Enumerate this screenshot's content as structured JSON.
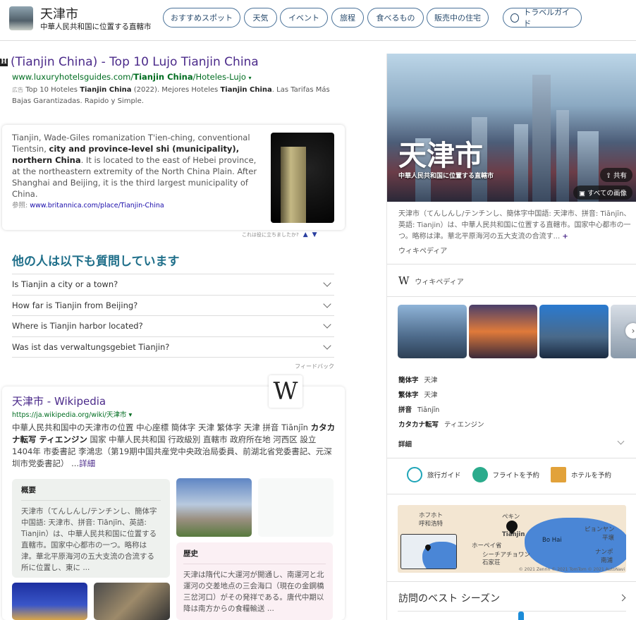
{
  "header": {
    "title": "天津市",
    "subtitle": "中華人民共和国に位置する直轄市",
    "pills": [
      "おすすめスポット",
      "天気",
      "イベント",
      "旅程",
      "食べるもの",
      "販売中の住宅"
    ],
    "travel_guide": "トラベルガイド"
  },
  "ad": {
    "title": "(Tianjin China) - Top 10 Lujo Tianjin China",
    "url_pre": "www.luxuryhotelsguides.com/",
    "url_bold": "Tianjin China",
    "url_post": "/Hoteles-Lujo",
    "ad_label": "広告",
    "desc_1": "Top 10 Hoteles ",
    "desc_b1": "Tianjin China",
    "desc_2": " (2022). Mejores Hoteles ",
    "desc_b2": "Tianjin China",
    "desc_3": ". Las Tarifas Más Bajas Garantizadas. Rapido y Simple."
  },
  "answer": {
    "text_1": "Tianjin, Wade-Giles romanization T'ien-ching, conventional Tientsin, ",
    "text_bold": "city and province-level shi (municipality), northern China",
    "text_2": ". It is located to the east of Hebei province, at the northeastern extremity of the North China Plain. After Shanghai and Beijing, it is the third largest municipality of China.",
    "ref_label": "参照: ",
    "ref_link": "www.britannica.com/place/Tianjin-China",
    "feedback": "これは役に立ちましたか?"
  },
  "paa": {
    "title": "他の人は以下も質問しています",
    "questions": [
      "Is Tianjin a city or a town?",
      "How far is Tianjin from Beijing?",
      "Where is Tianjin harbor located?",
      "Was ist das verwaltungsgebiet Tianjin?"
    ],
    "feedback": "フィードバック"
  },
  "wiki": {
    "logo": "W",
    "title": "天津市 - Wikipedia",
    "url": "https://ja.wikipedia.org/wiki/天津市 ▾",
    "d1": "中華人民共和国中の天津市の位置 中心座標 簡体字 天津 繁体字 天津 拼音 Tiānjīn ",
    "d_b": "カタカナ転写 ティエンジン",
    "d2": " 国家 中華人民共和国 行政級別 直轄市 政府所在地 河西区 設立 1404年 市委書記 李鴻忠（第19期中国共産党中央政治局委員、前湖北省党委書記、元深圳市党委書記） ...",
    "more": "詳細",
    "overview_title": "概要",
    "overview": "天津市（てんしんし/テンチンし、簡体字中国語: 天津市、拼音: Tiānjīn、英語: Tianjin）は、中華人民共和国に位置する直轄市。国家中心都市の一つ。略称は津。華北平原海河の五大支流の合流する所に位置し、東に ...",
    "history_title": "歴史",
    "history": "天津は隋代に大運河が開通し、南運河と北運河の交差地点の三会海口（現在の金鋼橋三岔河口）がその発祥である。唐代中期以降は南方からの食糧輸送 ..."
  },
  "panel": {
    "title": "天津市",
    "subtitle": "中華人民共和国に位置する直轄市",
    "share": "共有",
    "all_images": "すべての画像",
    "desc": "天津市（てんしんし/テンチンし、簡体字中国語: 天津市、拼音: Tiānjīn、英語: Tianjin）は、中華人民共和国に位置する直轄市。国家中心都市の一つ。略称は津。華北平原海河の五大支流の合流す...",
    "source": "ウィキペディア",
    "wiki_row": "ウィキペディア",
    "facts": [
      {
        "k": "簡体字",
        "v": "天津"
      },
      {
        "k": "繁体字",
        "v": "天津"
      },
      {
        "k": "拼音",
        "v": "Tiānjīn"
      },
      {
        "k": "カタカナ転写",
        "v": "ティエンジン"
      }
    ],
    "more": "詳細",
    "actions": [
      "旅行ガイド",
      "フライトを予約",
      "ホテルを予約"
    ],
    "map": {
      "labels": [
        "ホフホト",
        "呼和浩特",
        "ペキン",
        "Tianjin",
        "ホーペイ省",
        "シーチアチョワン",
        "石家荘",
        "Bo Hai",
        "ピョンヤン",
        "平壌",
        "ナンポ",
        "南浦"
      ],
      "credit": "© 2021 Zenrin © 2021 TomTom © 2021 AutoNavi"
    },
    "season": "訪問のベスト シーズン"
  }
}
